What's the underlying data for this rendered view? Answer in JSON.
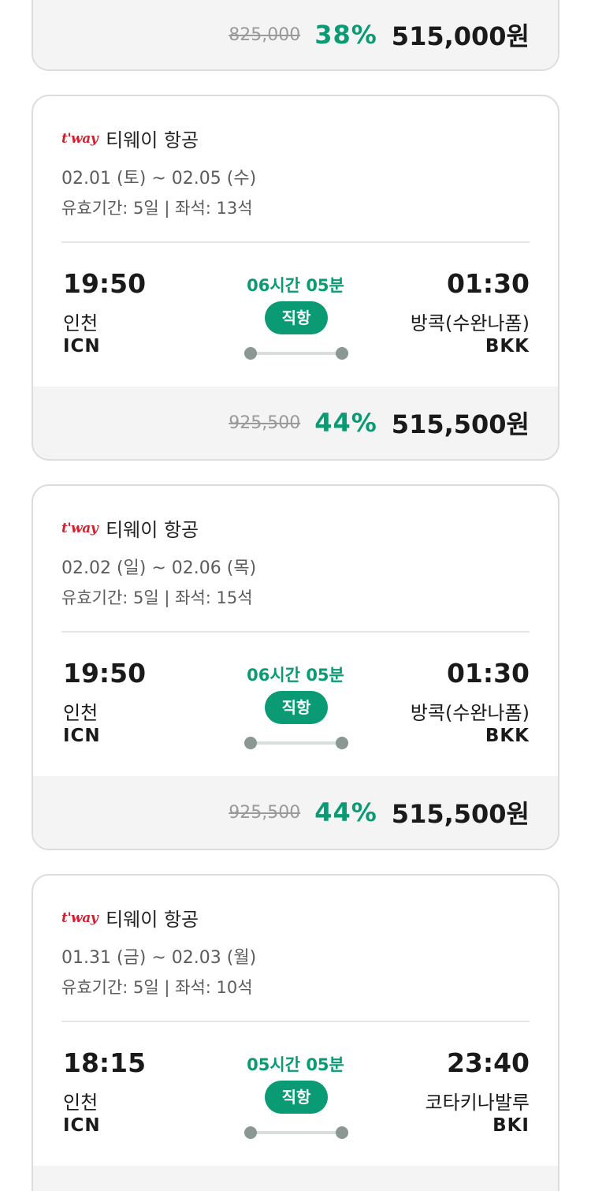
{
  "colors": {
    "accent": "#0a9b74",
    "logo": "#d1202f",
    "muted": "#5c5c5c",
    "strike": "#9a9a9a",
    "card_border": "#dcdcdc",
    "price_bg": "#f4f4f4"
  },
  "top_card": {
    "original_price": "825,000",
    "discount": "38%",
    "final_price": "515,000원"
  },
  "cards": [
    {
      "logo_text": "t'way",
      "airline": "티웨이 항공",
      "dates": "02.01 (토) ~ 02.05 (수)",
      "meta": "유효기간: 5일 | 좌석: 13석",
      "dep_time": "19:50",
      "dep_city": "인천",
      "dep_code": "ICN",
      "duration": "06시간 05분",
      "badge": "직항",
      "arr_time": "01:30",
      "arr_city": "방콕(수완나폼)",
      "arr_code": "BKK",
      "original_price": "925,500",
      "discount": "44%",
      "final_price": "515,500원"
    },
    {
      "logo_text": "t'way",
      "airline": "티웨이 항공",
      "dates": "02.02 (일) ~ 02.06 (목)",
      "meta": "유효기간: 5일 | 좌석: 15석",
      "dep_time": "19:50",
      "dep_city": "인천",
      "dep_code": "ICN",
      "duration": "06시간 05분",
      "badge": "직항",
      "arr_time": "01:30",
      "arr_city": "방콕(수완나폼)",
      "arr_code": "BKK",
      "original_price": "925,500",
      "discount": "44%",
      "final_price": "515,500원"
    },
    {
      "logo_text": "t'way",
      "airline": "티웨이 항공",
      "dates": "01.31 (금) ~ 02.03 (월)",
      "meta": "유효기간: 5일 | 좌석: 10석",
      "dep_time": "18:15",
      "dep_city": "인천",
      "dep_code": "ICN",
      "duration": "05시간 05분",
      "badge": "직항",
      "arr_time": "23:40",
      "arr_city": "코타키나발루",
      "arr_code": "BKI"
    }
  ]
}
